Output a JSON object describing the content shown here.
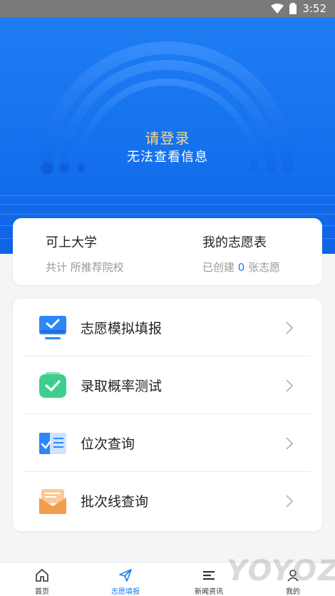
{
  "status_bar": {
    "time": "3:52"
  },
  "hero": {
    "login_title": "请登录",
    "login_subtitle": "无法查看信息"
  },
  "stats": {
    "left": {
      "title": "可上大学",
      "subtitle": "共计 所推荐院校"
    },
    "right": {
      "title": "我的志愿表",
      "sub_prefix": "已创建",
      "count": "0",
      "sub_suffix": "张志愿"
    }
  },
  "menu": [
    {
      "label": "志愿模拟填报",
      "icon": "monitor-check-icon"
    },
    {
      "label": "录取概率测试",
      "icon": "clipboard-check-icon"
    },
    {
      "label": "位次查询",
      "icon": "document-check-icon"
    },
    {
      "label": "批次线查询",
      "icon": "envelope-icon"
    }
  ],
  "tabbar": [
    {
      "label": "首页",
      "icon": "home-icon"
    },
    {
      "label": "志愿填报",
      "icon": "send-icon",
      "active": true
    },
    {
      "label": "新闻资讯",
      "icon": "news-icon"
    },
    {
      "label": "我的",
      "icon": "user-icon"
    }
  ],
  "watermark": "YOYOZ",
  "colors": {
    "primary": "#1a7ef5",
    "gold": "#ffd98a",
    "green": "#3ecf8e",
    "orange": "#f39c4a"
  }
}
